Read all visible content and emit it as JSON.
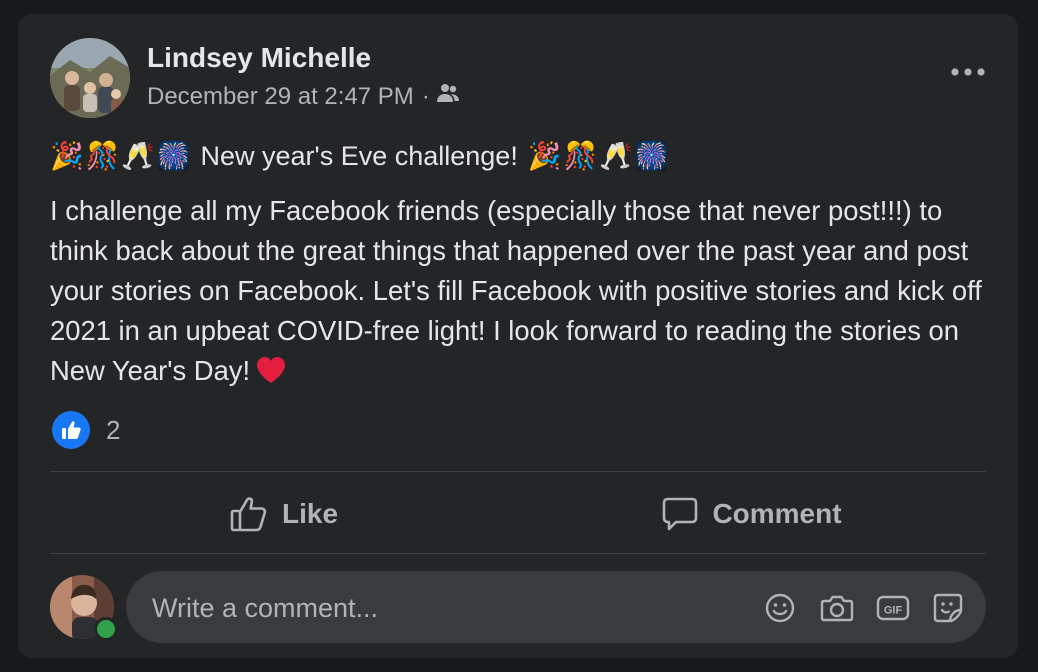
{
  "post": {
    "author": "Lindsey Michelle",
    "timestamp": "December 29 at 2:47 PM",
    "separator": "·",
    "audience_icon": "friends-icon",
    "title": "New year's Eve challenge!",
    "body": "I challenge all my Facebook friends (especially those that never post!!!) to think back about the great things that happened over the past year and post your stories on Facebook. Let's fill Facebook with positive stories and kick off 2021 in an upbeat COVID-free light! I look forward to reading the stories on New Year's Day!",
    "emojis": [
      "🎉",
      "🎊",
      "🥂",
      "🎆"
    ]
  },
  "reactions": {
    "icon": "like-reaction-icon",
    "count": "2"
  },
  "actions": {
    "like_label": "Like",
    "comment_label": "Comment"
  },
  "comment_box": {
    "placeholder": "Write a comment...",
    "icons": [
      "emoji-icon",
      "camera-icon",
      "gif-icon",
      "sticker-icon"
    ]
  },
  "colors": {
    "background": "#18191a",
    "card": "#242526",
    "text_primary": "#e4e6eb",
    "text_secondary": "#b0b3b8",
    "accent_blue": "#1877f2",
    "online_green": "#31a24c"
  }
}
